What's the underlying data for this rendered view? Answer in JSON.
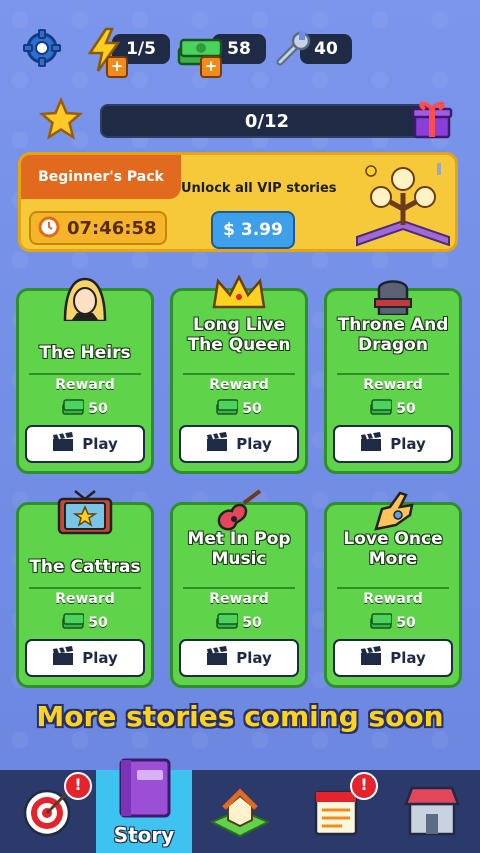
{
  "resources": {
    "energy": "1/5",
    "cash": "58",
    "tools": "40"
  },
  "progress": {
    "value": "0/12"
  },
  "pack": {
    "title": "Beginner's Pack",
    "timer": "07:46:58",
    "subtitle": "Unlock all VIP stories",
    "price": "$ 3.99"
  },
  "stories": [
    {
      "title": "The Heirs",
      "reward_label": "Reward",
      "reward": "50",
      "play": "Play"
    },
    {
      "title": "Long Live The Queen",
      "reward_label": "Reward",
      "reward": "50",
      "play": "Play"
    },
    {
      "title": "Throne And Dragon",
      "reward_label": "Reward",
      "reward": "50",
      "play": "Play"
    },
    {
      "title": "The Cattras",
      "reward_label": "Reward",
      "reward": "50",
      "play": "Play"
    },
    {
      "title": "Met In Pop Music",
      "reward_label": "Reward",
      "reward": "50",
      "play": "Play"
    },
    {
      "title": "Love Once More",
      "reward_label": "Reward",
      "reward": "50",
      "play": "Play"
    }
  ],
  "footer_text": "More stories coming soon",
  "nav": {
    "story_label": "Story",
    "alert_mark": "!"
  },
  "icons": [
    "settings-gear-icon",
    "energy-bolt-icon",
    "cash-stack-icon",
    "wrench-icon",
    "star-icon",
    "gift-icon",
    "alarm-clock-icon",
    "clapper-icon",
    "target-icon",
    "book-icon",
    "house-icon",
    "calendar-icon",
    "shop-icon"
  ],
  "colors": {
    "card_green": "#5fd44a",
    "pack_yellow": "#f6c93b",
    "accent_orange": "#e16a1f",
    "title_yellow": "#ffd21f"
  }
}
